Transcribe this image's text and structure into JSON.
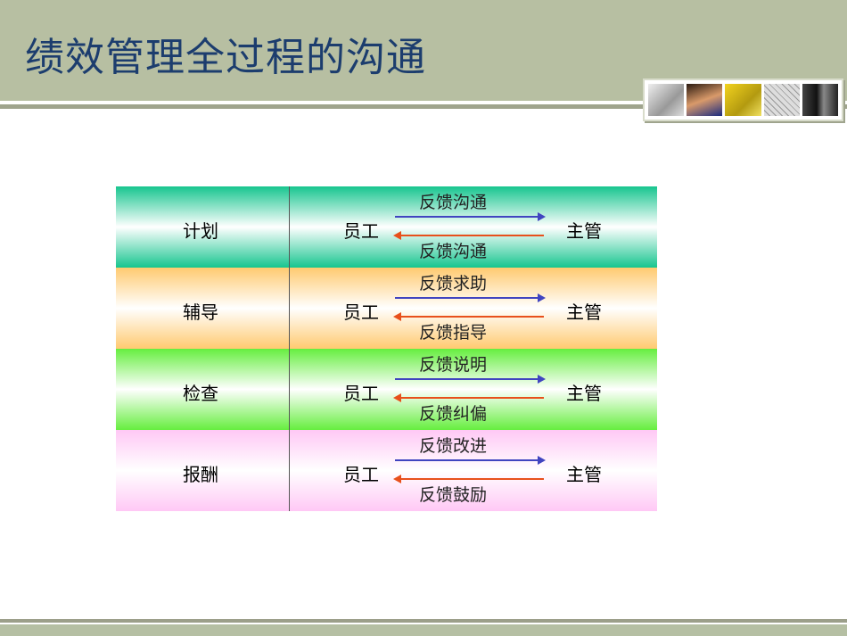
{
  "title": "绩效管理全过程的沟通",
  "rows": [
    {
      "stage": "计划",
      "employee": "员工",
      "manager": "主管",
      "up": "反馈沟通",
      "down": "反馈沟通"
    },
    {
      "stage": "辅导",
      "employee": "员工",
      "manager": "主管",
      "up": "反馈求助",
      "down": "反馈指导"
    },
    {
      "stage": "检查",
      "employee": "员工",
      "manager": "主管",
      "up": "反馈说明",
      "down": "反馈纠偏"
    },
    {
      "stage": "报酬",
      "employee": "员工",
      "manager": "主管",
      "up": "反馈改进",
      "down": "反馈鼓励"
    }
  ],
  "colors": {
    "header": "#b7bfa2",
    "title": "#1c3d6e",
    "row1": "#17c58f",
    "row2": "#ffca70",
    "row3": "#66ee3f",
    "row4": "#ffc8f5",
    "arrow_right": "#4044c0",
    "arrow_left": "#e8501c"
  }
}
